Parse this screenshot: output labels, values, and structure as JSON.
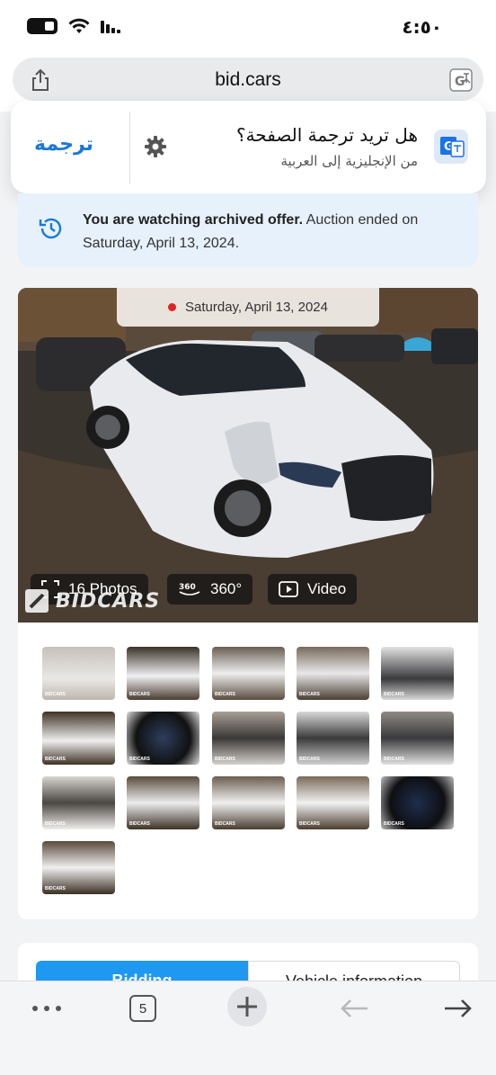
{
  "status": {
    "time": "٤:٥٠"
  },
  "browser": {
    "url": "bid.cars",
    "tab_count": "5"
  },
  "translate_popup": {
    "title": "هل تريد ترجمة الصفحة؟",
    "subtitle": "من الإنجليزية إلى العربية",
    "translate_button": "ترجمة"
  },
  "archive": {
    "bold": "You are watching archived offer.",
    "rest": " Auction ended on Saturday, April 13, 2024."
  },
  "hero": {
    "date": "Saturday, April 13, 2024",
    "photos_label": "16 Photos",
    "view360_label": "360°",
    "video_label": "Video",
    "logo_text": "BIDCARS",
    "icon_360_text": "360"
  },
  "thumb_tag": "BIDCARS",
  "tabs": {
    "bidding": "Bidding",
    "vehicle": "Vehicle information"
  },
  "colors": {
    "accent": "#1a78d8",
    "tab_active": "#1e98f0",
    "banner_bg": "#e6f1fb"
  }
}
